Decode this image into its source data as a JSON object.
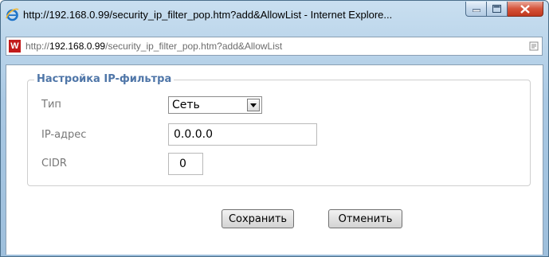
{
  "window": {
    "title": "http://192.168.0.99/security_ip_filter_pop.htm?add&AllowList - Internet Explore...",
    "controls": {
      "minimize_icon": "minimize-icon",
      "maximize_icon": "maximize-icon",
      "close_icon": "close-icon"
    }
  },
  "address_bar": {
    "prefix": "http://",
    "host": "192.168.0.99",
    "path": "/security_ip_filter_pop.htm?add&AllowList",
    "site_icon": "beward-logo-icon",
    "site_icon_letter": "W",
    "compat_icon": "compatibility-view-icon"
  },
  "form": {
    "legend": "Настройка IP-фильтра",
    "type_label": "Тип",
    "type_value": "Сеть",
    "ip_label": "IP-адрес",
    "ip_value": "0.0.0.0",
    "cidr_label": "CIDR",
    "cidr_value": "0"
  },
  "buttons": {
    "save": "Сохранить",
    "cancel": "Отменить"
  },
  "colors": {
    "legend": "#4f76a8",
    "label": "#777777",
    "close_button": "#c94a30",
    "frame": "#a9c8e3"
  }
}
